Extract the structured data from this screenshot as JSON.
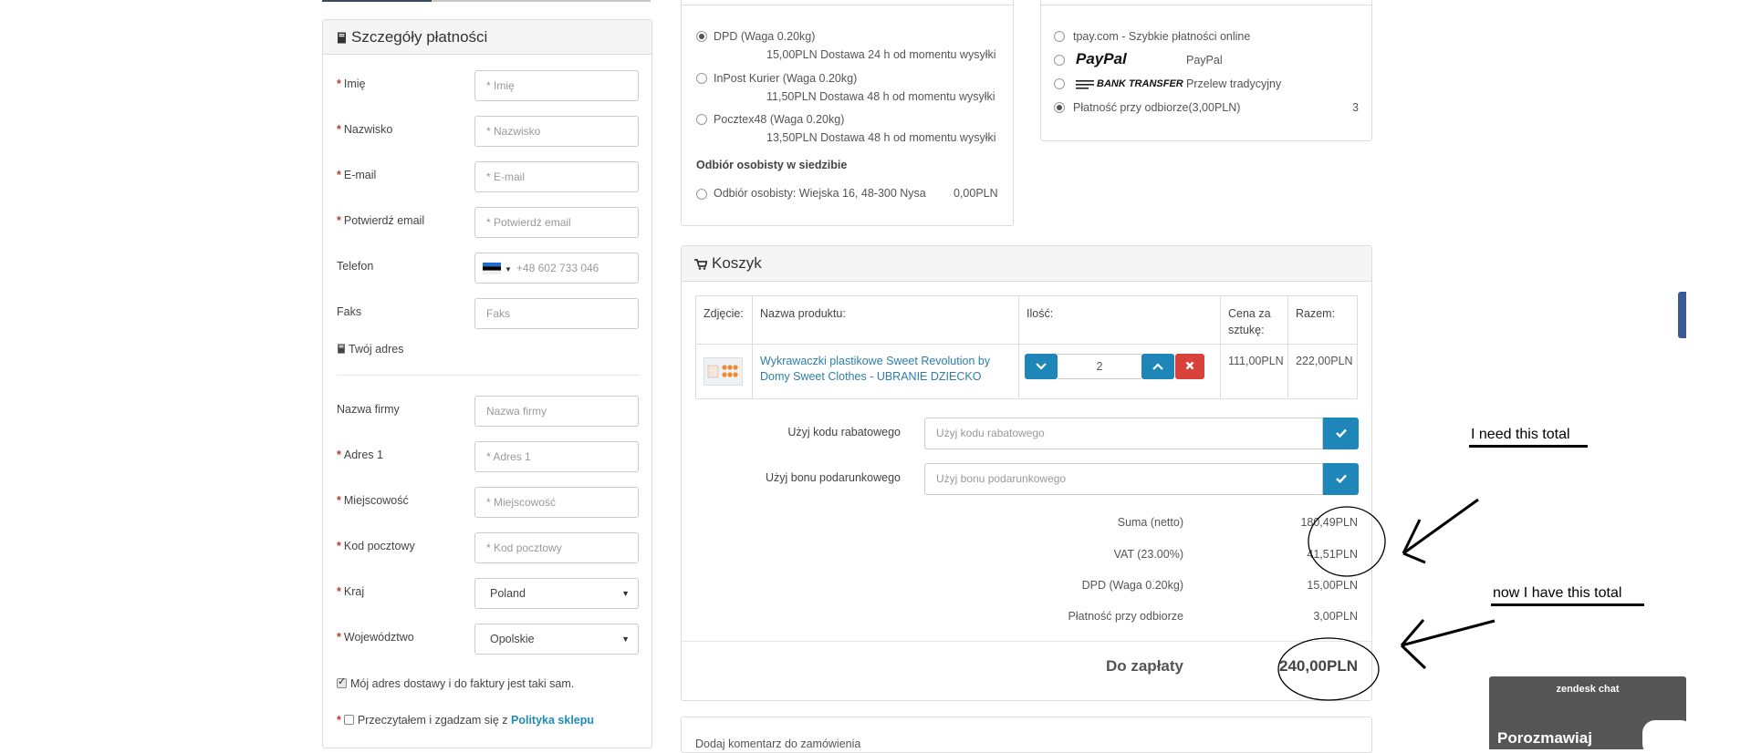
{
  "details": {
    "title": "Szczegóły płatności",
    "fields": [
      {
        "label": "Imię",
        "required": true,
        "placeholder": "* Imię"
      },
      {
        "label": "Nazwisko",
        "required": true,
        "placeholder": "* Nazwisko"
      },
      {
        "label": "E-mail",
        "required": true,
        "placeholder": "* E-mail"
      },
      {
        "label": "Potwierdź email",
        "required": true,
        "placeholder": "* Potwierdź email"
      },
      {
        "label": "Telefon",
        "required": false,
        "placeholder": "+48 602 733 046"
      },
      {
        "label": "Faks",
        "required": false,
        "placeholder": "Faks"
      }
    ],
    "address_heading": "Twój adres",
    "address_fields": [
      {
        "label": "Nazwa firmy",
        "required": false,
        "placeholder": "Nazwa firmy"
      },
      {
        "label": "Adres 1",
        "required": true,
        "placeholder": "* Adres 1"
      },
      {
        "label": "Miejscowość",
        "required": true,
        "placeholder": "* Miejscowość"
      },
      {
        "label": "Kod pocztowy",
        "required": true,
        "placeholder": "* Kod pocztowy"
      }
    ],
    "country": {
      "label": "Kraj",
      "value": "Poland"
    },
    "region": {
      "label": "Województwo",
      "value": "Opolskie"
    },
    "same_address": "Mój adres dostawy i do faktury jest taki sam.",
    "terms_prefix": "Przeczytałem i zgadzam się z",
    "terms_link": "Polityka sklepu"
  },
  "shipping": {
    "options": [
      {
        "name": "DPD (Waga 0.20kg)",
        "detail": "15,00PLN Dostawa 24 h od momentu wysyłki",
        "selected": true
      },
      {
        "name": "InPost Kurier (Waga 0.20kg)",
        "detail": "11,50PLN Dostawa 48 h od momentu wysyłki",
        "selected": false
      },
      {
        "name": "Pocztex48 (Waga 0.20kg)",
        "detail": "13,50PLN Dostawa 48 h od momentu wysyłki",
        "selected": false
      }
    ],
    "pickup_heading": "Odbiór osobisty w siedzibie",
    "pickup": {
      "name": "Odbiór osobisty: Wiejska 16, 48-300 Nysa",
      "price": "0,00PLN"
    }
  },
  "payment": {
    "options": [
      {
        "logo": "",
        "name": "tpay.com - Szybkie płatności online",
        "selected": false
      },
      {
        "logo": "PayPal",
        "name": "PayPal",
        "selected": false
      },
      {
        "logo": "BANK TRANSFER",
        "name": "Przelew tradycyjny",
        "selected": false
      },
      {
        "logo": "",
        "name": "Płatność przy odbiorze(3,00PLN)",
        "selected": true,
        "extra": "3"
      }
    ]
  },
  "cart": {
    "title": "Koszyk",
    "columns": [
      "Zdjęcie:",
      "Nazwa produktu:",
      "Ilość:",
      "Cena za sztukę:",
      "Razem:"
    ],
    "item": {
      "name": "Wykrawaczki plastikowe Sweet Revolution by Domy Sweet Clothes - UBRANIE DZIECKO",
      "qty": "2",
      "price": "111,00PLN",
      "total": "222,00PLN"
    },
    "discount_label": "Użyj kodu rabatowego",
    "discount_placeholder": "Użyj kodu rabatowego",
    "voucher_label": "Użyj bonu podarunkowego",
    "voucher_placeholder": "Użyj bonu podarunkowego",
    "summary": [
      {
        "label": "Suma (netto)",
        "value": "180,49PLN"
      },
      {
        "label": "VAT (23.00%)",
        "value": "41,51PLN"
      },
      {
        "label": "DPD (Waga 0.20kg)",
        "value": "15,00PLN"
      },
      {
        "label": "Płatność przy odbiorze",
        "value": "3,00PLN"
      }
    ],
    "total_label": "Do zapłaty",
    "total_value": "240,00PLN"
  },
  "comment": {
    "label": "Dodaj komentarz do zamówienia"
  },
  "annotations": {
    "need": "I need this total",
    "have": "now I have this total"
  },
  "zendesk": {
    "title": "zendesk chat",
    "message": "Porozmawiaj"
  },
  "colors": {
    "accent": "#1e86b9",
    "danger": "#d9423a",
    "required": "#c0392b"
  }
}
